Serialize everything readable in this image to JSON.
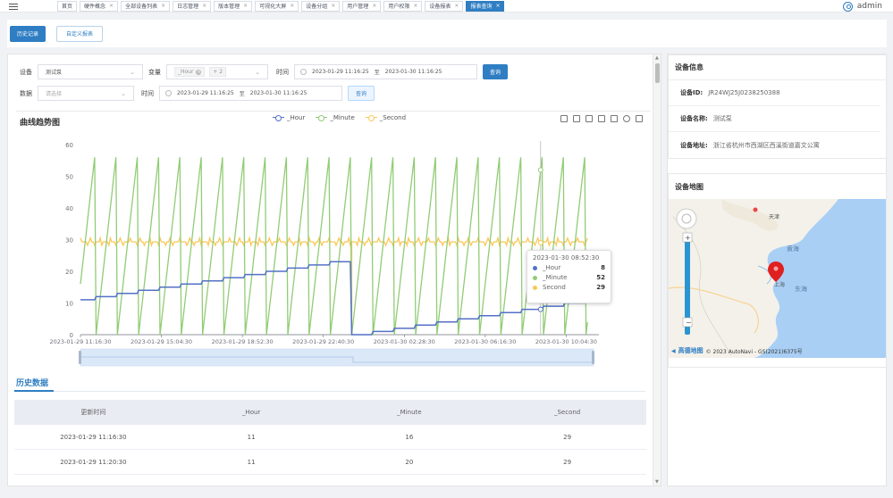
{
  "topbar": {
    "tabs": [
      "首页",
      "硬件概念",
      "全部设备列表",
      "日志管理",
      "版本管理",
      "可视化大屏",
      "设备分组",
      "用户管理",
      "用户权限",
      "设备报表",
      "报表查询"
    ],
    "active_tab_index": 10,
    "close_glyph": "×",
    "user_name": "admin"
  },
  "buttons": {
    "history": "历史记录",
    "custom": "自定义报表"
  },
  "filters": {
    "device_label": "设备",
    "device_value": "测试泵",
    "variable_label": "变量",
    "variable_chip": "_Hour",
    "variable_more": "+ 2",
    "time_label": "时间",
    "time_start": "2023-01-29 11:16:25",
    "time_sep": "至",
    "time_end": "2023-01-30 11:16:25",
    "query_label": "查询",
    "data_label": "数据",
    "data_placeholder": "请选择",
    "time2_label": "时间",
    "time2_start": "2023-01-29 11:16:25",
    "time2_sep": "至",
    "time2_end": "2023-01-30 11:16:25",
    "query2_label": "查询"
  },
  "chart_section_title": "曲线趋势图",
  "chart_data": {
    "type": "line",
    "x_ticks": [
      "2023-01-29 11:16:30",
      "2023-01-29 15:04:30",
      "2023-01-29 18:52:30",
      "2023-01-29 22:40:30",
      "2023-01-30 02:28:30",
      "2023-01-30 06:16:30",
      "2023-01-30 10:04:30"
    ],
    "ylim": [
      0,
      60
    ],
    "y_ticks": [
      0,
      10,
      20,
      30,
      40,
      50,
      60
    ],
    "series": [
      {
        "name": "_Hour",
        "color": "#5470c6",
        "description": "step increases 11→23 then resets to 0 and climbs to 10"
      },
      {
        "name": "_Minute",
        "color": "#91cc75",
        "description": "sawtooth 0–56 repeating each hour"
      },
      {
        "name": "_Second",
        "color": "#fac858",
        "description": "noisy around 29-30"
      }
    ],
    "legend_position": "top-center",
    "grid": false,
    "tooltip": {
      "time": "2023-01-30 08:52:30",
      "rows": [
        {
          "name": "_Hour",
          "value": "8"
        },
        {
          "name": "_Minute",
          "value": "52"
        },
        {
          "name": "Second",
          "value": "29"
        }
      ]
    }
  },
  "history": {
    "tab_label": "历史数据",
    "columns": [
      "更新时间",
      "_Hour",
      "_Minute",
      "_Second"
    ],
    "rows": [
      [
        "2023-01-29 11:16:30",
        "11",
        "16",
        "29"
      ],
      [
        "2023-01-29 11:20:30",
        "11",
        "20",
        "29"
      ]
    ]
  },
  "device_info": {
    "title": "设备信息",
    "id_label": "设备ID:",
    "id_value": "JR24WJ25J0238250388",
    "name_label": "设备名称:",
    "name_value": "测试泵",
    "addr_label": "设备地址:",
    "addr_value": "浙江省杭州市西湖区西溪街道嘉文公寓"
  },
  "device_map": {
    "title": "设备地图",
    "labels": [
      "黄海",
      "东海"
    ],
    "attribution_brand": "高德地图",
    "attribution_text": "© 2023 AutoNavi - GS(2021)6375号",
    "marker_color": "#e02020"
  }
}
